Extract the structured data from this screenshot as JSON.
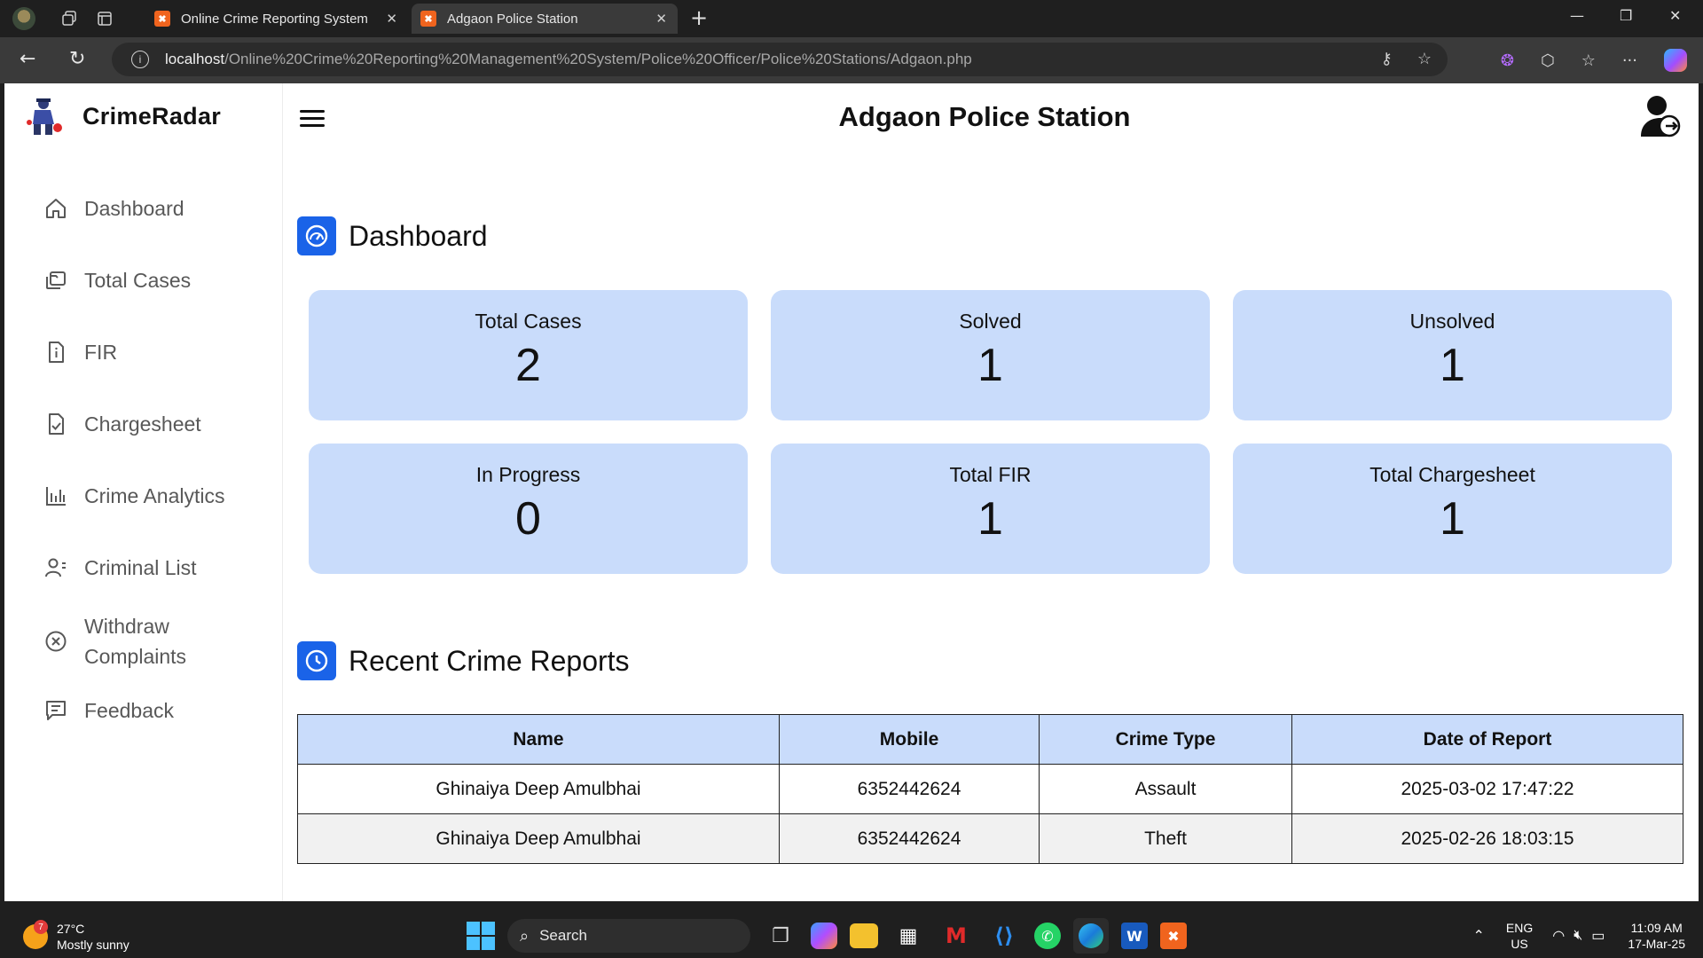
{
  "browser": {
    "tabs": [
      {
        "title": "Online Crime Reporting System",
        "active": false
      },
      {
        "title": "Adgaon Police Station",
        "active": true
      }
    ],
    "url_host": "localhost",
    "url_path": "/Online%20Crime%20Reporting%20Management%20System/Police%20Officer/Police%20Stations/Adgaon.php"
  },
  "sidebar": {
    "brand": "CrimeRadar",
    "items": [
      {
        "label": "Dashboard",
        "icon": "home-icon"
      },
      {
        "label": "Total Cases",
        "icon": "cases-icon"
      },
      {
        "label": "FIR",
        "icon": "document-info-icon"
      },
      {
        "label": "Chargesheet",
        "icon": "document-check-icon"
      },
      {
        "label": "Crime Analytics",
        "icon": "bar-chart-icon"
      },
      {
        "label": "Criminal List",
        "icon": "user-list-icon"
      },
      {
        "label": "Withdraw Complaints",
        "icon": "circle-x-icon"
      },
      {
        "label": "Feedback",
        "icon": "feedback-icon"
      }
    ]
  },
  "header": {
    "title": "Adgaon Police Station"
  },
  "dashboard": {
    "title": "Dashboard",
    "cards": [
      {
        "label": "Total Cases",
        "value": "2"
      },
      {
        "label": "Solved",
        "value": "1"
      },
      {
        "label": "Unsolved",
        "value": "1"
      },
      {
        "label": "In Progress",
        "value": "0"
      },
      {
        "label": "Total FIR",
        "value": "1"
      },
      {
        "label": "Total Chargesheet",
        "value": "1"
      }
    ]
  },
  "recent": {
    "title": "Recent Crime Reports",
    "columns": [
      "Name",
      "Mobile",
      "Crime Type",
      "Date of Report"
    ],
    "rows": [
      [
        "Ghinaiya Deep Amulbhai",
        "6352442624",
        "Assault",
        "2025-03-02 17:47:22"
      ],
      [
        "Ghinaiya Deep Amulbhai",
        "6352442624",
        "Theft",
        "2025-02-26 18:03:15"
      ]
    ]
  },
  "taskbar": {
    "temperature": "27°C",
    "weather": "Mostly sunny",
    "weather_badge": "7",
    "search_placeholder": "Search",
    "lang": "ENG",
    "region": "US",
    "time": "11:09 AM",
    "date": "17-Mar-25"
  },
  "colors": {
    "accent": "#1a63e8",
    "card_bg": "#c9dcfb",
    "table_header_bg": "#c9dcfb"
  }
}
